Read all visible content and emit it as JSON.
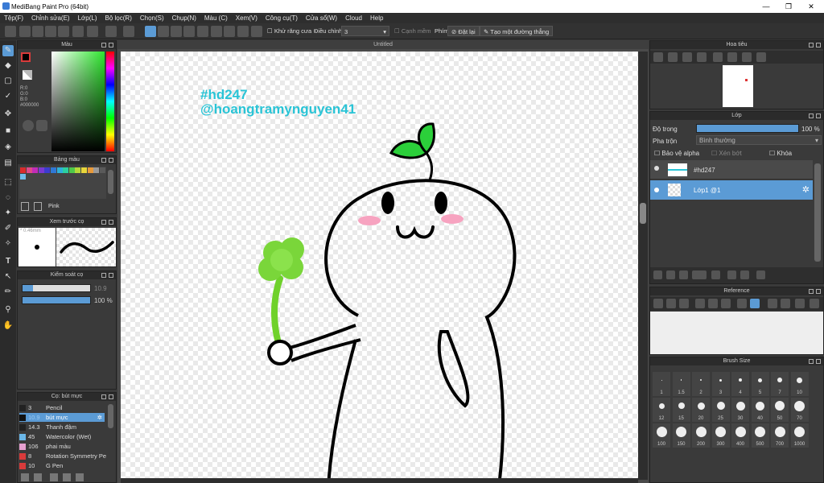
{
  "app": {
    "title": "MediBang Paint Pro (64bit)"
  },
  "menu": [
    "Tệp(F)",
    "Chỉnh sửa(E)",
    "Lớp(L)",
    "Bộ lọc(R)",
    "Chọn(S)",
    "Chụp(N)",
    "Màu (C)",
    "Xem(V)",
    "Công cụ(T)",
    "Cửa sổ(W)",
    "Cloud",
    "Help"
  ],
  "toolbar": {
    "antialias": "Khử răng cưa",
    "correction_label": "Điều chỉnh",
    "correction_value": "3",
    "smooth": "Cạnh mềm",
    "key_label": "Phím",
    "reset": "Đặt lại",
    "straight": "Tạo một đường thẳng"
  },
  "document": {
    "tab": "Untitled",
    "text1": "#hd247",
    "text2": "@hoangtramynguyen41"
  },
  "color_panel": {
    "title": "Màu",
    "r": "R:0",
    "g": "G:0",
    "b": "B:0",
    "hex": "#000000"
  },
  "palette_panel": {
    "title": "Bảng màu",
    "name": "Pink",
    "colors": [
      "#d92b2b",
      "#e04a8a",
      "#c22cb8",
      "#7a3ad1",
      "#3c3ccf",
      "#2f78d6",
      "#2fb0d9",
      "#2bcfa0",
      "#4fc94a",
      "#b5d93a",
      "#e8d63a",
      "#e89a3a",
      "#9a9a9a",
      "#5a5a5a",
      "#6fbbe8"
    ]
  },
  "preview_panel": {
    "title": "Xem trước cọ",
    "size": "0.46mm"
  },
  "brush_control": {
    "title": "Kiểm soát cọ",
    "size": "10.9",
    "opacity": "100 %",
    "size_fill": 0.15,
    "opacity_fill": 1.0
  },
  "brush_list": {
    "title": "Cọ: bút mực",
    "items": [
      {
        "size": "3",
        "name": "Pencil",
        "color": "#222222"
      },
      {
        "size": "10.9",
        "name": "bút mực",
        "color": "#111111",
        "selected": true
      },
      {
        "size": "14.3",
        "name": "Thanh đậm",
        "color": "#222222"
      },
      {
        "size": "45",
        "name": "Watercolor (Wet)",
        "color": "#6ab7e8"
      },
      {
        "size": "106",
        "name": "phai màu",
        "color": "#e6a0d0"
      },
      {
        "size": "8",
        "name": "Rotation Symmetry Pe",
        "color": "#d93b3b"
      },
      {
        "size": "10",
        "name": "G Pen",
        "color": "#d93b3b"
      }
    ]
  },
  "navigator": {
    "title": "Hoa tiêu"
  },
  "layer_panel": {
    "title": "Lớp",
    "opacity_label": "Độ trong",
    "opacity_value": "100 %",
    "blend_label": "Pha trộn",
    "blend_value": "Bình thường",
    "protect_alpha": "Bảo vệ alpha",
    "clipping": "Xén bớt",
    "lock": "Khóa",
    "layers": [
      {
        "name": "#hd247",
        "selected": false
      },
      {
        "name": "Lớp1 @1",
        "selected": true
      }
    ]
  },
  "reference_panel": {
    "title": "Reference"
  },
  "brush_size_panel": {
    "title": "Brush Size",
    "sizes": [
      "1",
      "1.5",
      "2",
      "3",
      "4",
      "5",
      "7",
      "10",
      "12",
      "15",
      "20",
      "25",
      "30",
      "40",
      "50",
      "70",
      "100",
      "150",
      "200",
      "300",
      "400",
      "500",
      "700",
      "1000"
    ]
  }
}
